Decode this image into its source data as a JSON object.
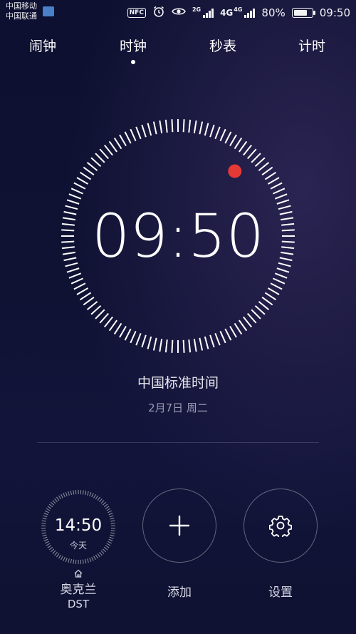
{
  "status_bar": {
    "carrier_1": "中国移动",
    "carrier_2": "中国联通",
    "nfc_label": "NFC",
    "net_1": "2G",
    "net_2": "4G",
    "net_3": "4G",
    "battery": "80%",
    "battery_level": 0.8,
    "time": "09:50",
    "icons": [
      "carrier-app-icon",
      "nfc-icon",
      "alarm-icon",
      "eye-comfort-icon",
      "signal-icon",
      "battery-icon"
    ]
  },
  "tabs": [
    {
      "label": "闹钟",
      "active": false
    },
    {
      "label": "时钟",
      "active": true
    },
    {
      "label": "秒表",
      "active": false
    },
    {
      "label": "计时",
      "active": false
    }
  ],
  "main_clock": {
    "time": "09:50",
    "timezone": "中国标准时间",
    "date": "2月7日 周二",
    "second_marker_color": "#e53935"
  },
  "world_clock": {
    "time": "14:50",
    "day": "今天",
    "city": "奥克兰",
    "dst": "DST"
  },
  "actions": {
    "add_label": "添加",
    "settings_label": "设置"
  },
  "colors": {
    "background": "#101234",
    "accent_red": "#e53935",
    "text_primary": "#ffffff",
    "text_secondary": "#9a9cb4"
  }
}
